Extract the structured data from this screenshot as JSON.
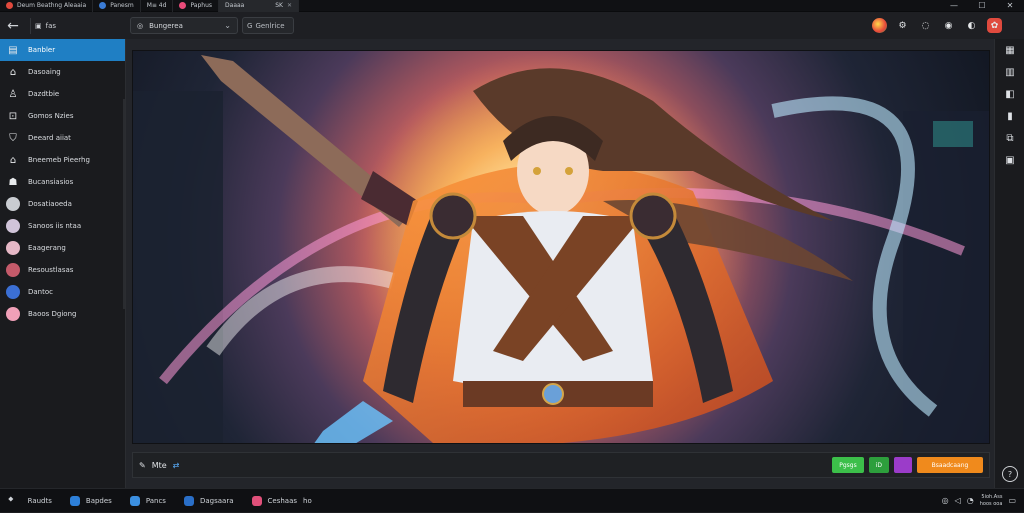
{
  "tabs": [
    {
      "label": "Deum Beathng Aleaaia",
      "active": false
    },
    {
      "label": "Panesm",
      "active": false
    },
    {
      "label": "M≡ 4d",
      "active": false
    },
    {
      "label": "Paphus",
      "active": false
    },
    {
      "label": "Daaaa",
      "active": true,
      "extra": "SK"
    }
  ],
  "window_controls": {
    "minimize": "—",
    "maximize": "☐",
    "close": "✕"
  },
  "toolbar": {
    "back": "←",
    "breadcrumb": "fas",
    "select_value": "Bungerea",
    "search_text": "Genlrice"
  },
  "sidebar": {
    "items": [
      {
        "label": "Banbler",
        "active": true
      },
      {
        "label": "Dasoaing"
      },
      {
        "label": "Dazdtbie"
      },
      {
        "label": "Gomos Nzies"
      },
      {
        "label": "Deeard aiiat"
      },
      {
        "label": "Bneemeb Pieerhg"
      },
      {
        "label": "Bucansiasios"
      },
      {
        "label": "Dosatiaoeda"
      },
      {
        "label": "Sanoos iis ntaa"
      },
      {
        "label": "Eaagerang"
      },
      {
        "label": "Resoustlasas"
      },
      {
        "label": "Dantoc"
      },
      {
        "label": "Baoos Dgiong"
      }
    ]
  },
  "bottombar": {
    "left_label": "Mte",
    "buttons": [
      "Pgsgs",
      "iD",
      "",
      "Bsaadcaang"
    ]
  },
  "taskbar": {
    "items": [
      "Raudts",
      "Bapdes",
      "Pancs",
      "Dagsaara",
      "Ceshaas",
      "ho"
    ],
    "clock_time": "5ioh.Ass",
    "clock_date": "hoos ooa"
  }
}
